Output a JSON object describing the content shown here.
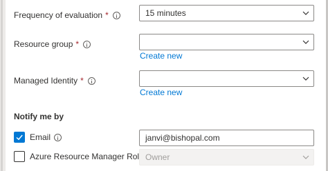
{
  "frequency": {
    "label": "Frequency of evaluation",
    "required_mark": "*",
    "value": "15 minutes"
  },
  "resource_group": {
    "label": "Resource group",
    "required_mark": "*",
    "value": "",
    "create_link": "Create new"
  },
  "managed_identity": {
    "label": "Managed Identity",
    "required_mark": "*",
    "value": "",
    "create_link": "Create new"
  },
  "notify": {
    "title": "Notify me by",
    "email": {
      "label": "Email",
      "checked": true,
      "value": "janvi@bishopal.com"
    },
    "arm_role": {
      "label": "Azure Resource Manager Role",
      "checked": false,
      "value": "Owner",
      "disabled": true
    }
  },
  "colors": {
    "accent": "#0078d4",
    "required": "#a4262c",
    "text": "#323130",
    "border": "#8a8886",
    "disabled_bg": "#f3f2f1",
    "disabled_text": "#a19f9d"
  },
  "icons": [
    "info-icon",
    "chevron-down-icon",
    "checkmark-icon"
  ]
}
